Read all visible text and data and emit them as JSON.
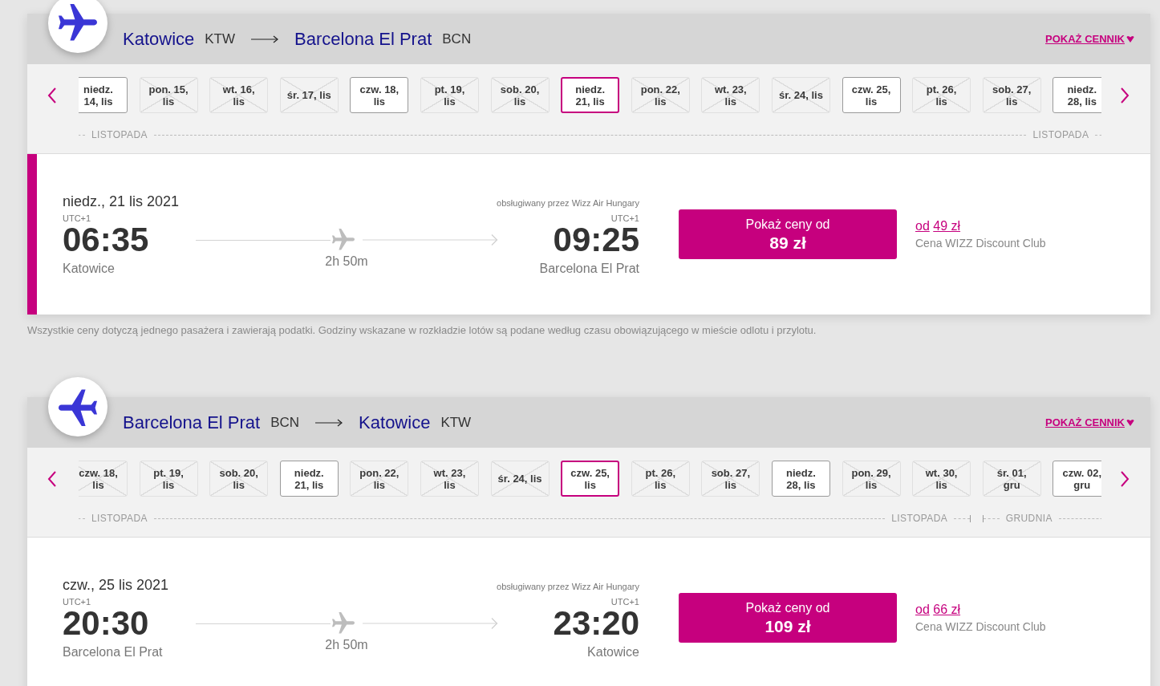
{
  "sections": [
    {
      "kind": "outbound",
      "route": {
        "from_city": "Katowice",
        "from_code": "KTW",
        "to_city": "Barcelona El Prat",
        "to_code": "BCN"
      },
      "price_list_link": "POKAŻ CENNIK",
      "date_strip": {
        "months": [
          {
            "label": "LISTOPADA",
            "end_label": "LISTOPADA",
            "dates": [
              {
                "label": "niedz.\n14, lis",
                "available": true,
                "selected": false
              },
              {
                "label": "pon. 15,\nlis",
                "available": false,
                "selected": false
              },
              {
                "label": "wt. 16,\nlis",
                "available": false,
                "selected": false
              },
              {
                "label": "śr. 17, lis",
                "available": false,
                "selected": false
              },
              {
                "label": "czw. 18,\nlis",
                "available": true,
                "selected": false
              },
              {
                "label": "pt. 19,\nlis",
                "available": false,
                "selected": false
              },
              {
                "label": "sob. 20,\nlis",
                "available": false,
                "selected": false
              },
              {
                "label": "niedz.\n21, lis",
                "available": true,
                "selected": true
              },
              {
                "label": "pon. 22,\nlis",
                "available": false,
                "selected": false
              },
              {
                "label": "wt. 23,\nlis",
                "available": false,
                "selected": false
              },
              {
                "label": "śr. 24, lis",
                "available": false,
                "selected": false
              },
              {
                "label": "czw. 25,\nlis",
                "available": true,
                "selected": false
              },
              {
                "label": "pt. 26,\nlis",
                "available": false,
                "selected": false
              },
              {
                "label": "sob. 27,\nlis",
                "available": false,
                "selected": false
              },
              {
                "label": "niedz.\n28, lis",
                "available": true,
                "selected": false
              }
            ]
          }
        ]
      },
      "flight": {
        "selected": true,
        "date": "niedz., 21 lis 2021",
        "operated_by": "obsługiwany przez Wizz Air Hungary",
        "departure": {
          "timezone": "UTC+1",
          "time": "06:35",
          "city": "Katowice"
        },
        "duration": "2h 50m",
        "arrival": {
          "timezone": "UTC+1",
          "time": "09:25",
          "city": "Barcelona El Prat"
        },
        "price_button": {
          "label": "Pokaż ceny od",
          "price": "89 zł"
        },
        "club_price": {
          "prefix": "od",
          "price": "49 zł",
          "caption": "Cena WIZZ Discount Club"
        }
      },
      "note": "Wszystkie ceny dotyczą jednego pasażera i zawierają podatki. Godziny wskazane w rozkładzie lotów są podane według czasu obowiązującego w mieście odlotu i przylotu."
    },
    {
      "kind": "return",
      "route": {
        "from_city": "Barcelona El Prat",
        "from_code": "BCN",
        "to_city": "Katowice",
        "to_code": "KTW"
      },
      "price_list_link": "POKAŻ CENNIK",
      "date_strip": {
        "months": [
          {
            "label": "LISTOPADA",
            "end_label": "LISTOPADA",
            "dates": [
              {
                "label": "czw. 18,\nlis",
                "available": false,
                "selected": false
              },
              {
                "label": "pt. 19,\nlis",
                "available": false,
                "selected": false
              },
              {
                "label": "sob. 20,\nlis",
                "available": false,
                "selected": false
              },
              {
                "label": "niedz.\n21, lis",
                "available": true,
                "selected": false
              },
              {
                "label": "pon. 22,\nlis",
                "available": false,
                "selected": false
              },
              {
                "label": "wt. 23,\nlis",
                "available": false,
                "selected": false
              },
              {
                "label": "śr. 24, lis",
                "available": false,
                "selected": false
              },
              {
                "label": "czw. 25,\nlis",
                "available": true,
                "selected": true
              },
              {
                "label": "pt. 26,\nlis",
                "available": false,
                "selected": false
              },
              {
                "label": "sob. 27,\nlis",
                "available": false,
                "selected": false
              },
              {
                "label": "niedz.\n28, lis",
                "available": true,
                "selected": false
              },
              {
                "label": "pon. 29,\nlis",
                "available": false,
                "selected": false
              },
              {
                "label": "wt. 30,\nlis",
                "available": false,
                "selected": false
              }
            ]
          },
          {
            "label": "GRUDNIA",
            "dates": [
              {
                "label": "śr. 01,\ngru",
                "available": false,
                "selected": false
              },
              {
                "label": "czw. 02,\ngru",
                "available": true,
                "selected": false
              }
            ]
          }
        ]
      },
      "flight": {
        "selected": false,
        "date": "czw., 25 lis 2021",
        "operated_by": "obsługiwany przez Wizz Air Hungary",
        "departure": {
          "timezone": "UTC+1",
          "time": "20:30",
          "city": "Barcelona El Prat"
        },
        "duration": "2h 50m",
        "arrival": {
          "timezone": "UTC+1",
          "time": "23:20",
          "city": "Katowice"
        },
        "price_button": {
          "label": "Pokaż ceny od",
          "price": "109 zł"
        },
        "club_price": {
          "prefix": "od",
          "price": "66 zł",
          "caption": "Cena WIZZ Discount Club"
        }
      }
    }
  ]
}
